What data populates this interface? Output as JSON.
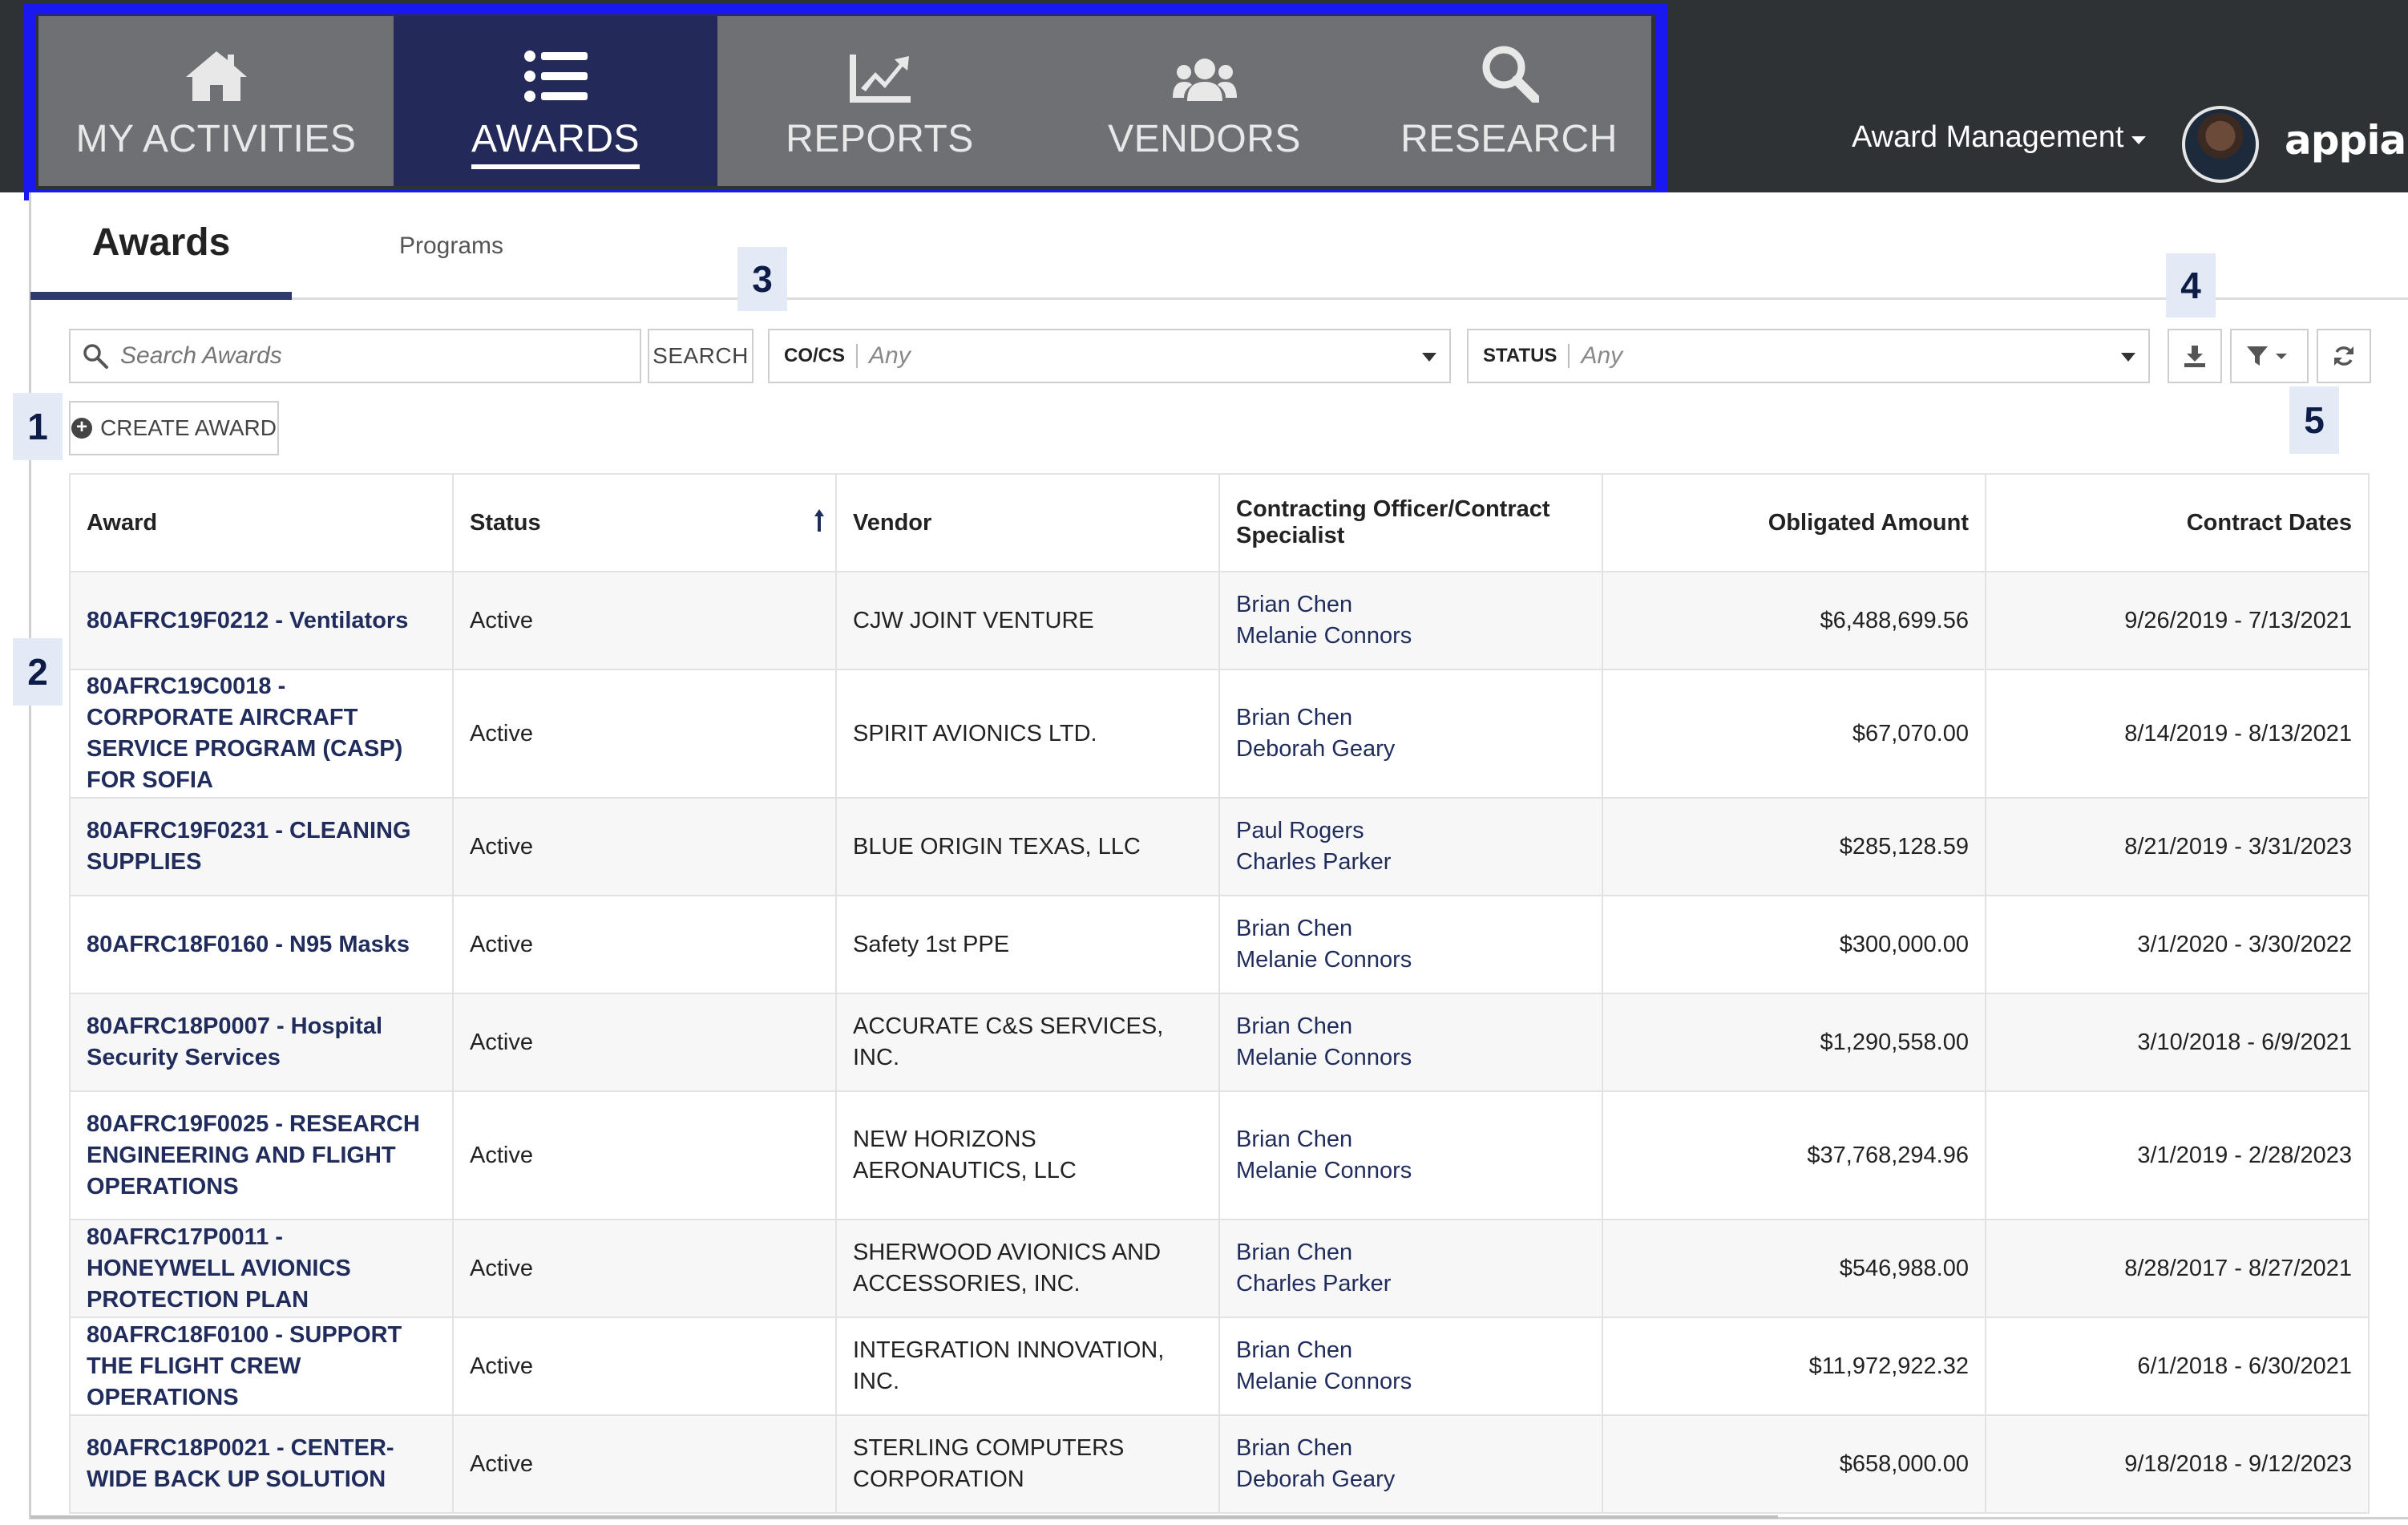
{
  "nav": {
    "items": [
      {
        "label": "MY ACTIVITIES",
        "icon": "home-icon"
      },
      {
        "label": "AWARDS",
        "icon": "list-icon"
      },
      {
        "label": "REPORTS",
        "icon": "chart-icon"
      },
      {
        "label": "VENDORS",
        "icon": "users-icon"
      },
      {
        "label": "RESEARCH",
        "icon": "search-icon"
      }
    ],
    "active": "AWARDS"
  },
  "header": {
    "app_menu_label": "Award Management",
    "logo_text": "appian"
  },
  "tabs": [
    {
      "label": "Awards"
    },
    {
      "label": "Programs"
    }
  ],
  "filters": {
    "search_placeholder": "Search Awards",
    "search_button": "SEARCH",
    "cocs_label": "CO/CS",
    "cocs_value": "Any",
    "status_label": "STATUS",
    "status_value": "Any"
  },
  "actions": {
    "create_award": "CREATE AWARD"
  },
  "badges": [
    "1",
    "2",
    "3",
    "4",
    "5"
  ],
  "table": {
    "columns": [
      "Award",
      "Status",
      "Vendor",
      "Contracting Officer/Contract Specialist",
      "Obligated Amount",
      "Contract Dates"
    ],
    "rows": [
      {
        "award": "80AFRC19F0212 - Ventilators",
        "status": "Active",
        "vendor": "CJW JOINT VENTURE",
        "officer": "Brian Chen",
        "specialist": "Melanie Connors",
        "amount": "$6,488,699.56",
        "dates": "9/26/2019 - 7/13/2021"
      },
      {
        "award": "80AFRC19C0018 - CORPORATE AIRCRAFT SERVICE PROGRAM (CASP) FOR SOFIA",
        "status": "Active",
        "vendor": "SPIRIT AVIONICS LTD.",
        "officer": "Brian Chen",
        "specialist": "Deborah Geary",
        "amount": "$67,070.00",
        "dates": "8/14/2019 - 8/13/2021"
      },
      {
        "award": "80AFRC19F0231 - CLEANING SUPPLIES",
        "status": "Active",
        "vendor": "BLUE ORIGIN TEXAS, LLC",
        "officer": "Paul Rogers",
        "specialist": "Charles Parker",
        "amount": "$285,128.59",
        "dates": "8/21/2019 - 3/31/2023"
      },
      {
        "award": "80AFRC18F0160 - N95 Masks",
        "status": "Active",
        "vendor": "Safety 1st PPE",
        "officer": "Brian Chen",
        "specialist": "Melanie Connors",
        "amount": "$300,000.00",
        "dates": "3/1/2020 - 3/30/2022"
      },
      {
        "award": "80AFRC18P0007 - Hospital Security Services",
        "status": "Active",
        "vendor": "ACCURATE C&S SERVICES, INC.",
        "officer": "Brian Chen",
        "specialist": "Melanie Connors",
        "amount": "$1,290,558.00",
        "dates": "3/10/2018 - 6/9/2021"
      },
      {
        "award": "80AFRC19F0025 - RESEARCH ENGINEERING AND FLIGHT OPERATIONS",
        "status": "Active",
        "vendor": "NEW HORIZONS AERONAUTICS, LLC",
        "officer": "Brian Chen",
        "specialist": "Melanie Connors",
        "amount": "$37,768,294.96",
        "dates": "3/1/2019 - 2/28/2023"
      },
      {
        "award": "80AFRC17P0011 - HONEYWELL AVIONICS PROTECTION PLAN",
        "status": "Active",
        "vendor": "SHERWOOD AVIONICS AND ACCESSORIES, INC.",
        "officer": "Brian Chen",
        "specialist": "Charles Parker",
        "amount": "$546,988.00",
        "dates": "8/28/2017 - 8/27/2021"
      },
      {
        "award": "80AFRC18F0100 - SUPPORT THE FLIGHT CREW OPERATIONS",
        "status": "Active",
        "vendor": "INTEGRATION INNOVATION, INC.",
        "officer": "Brian Chen",
        "specialist": "Melanie Connors",
        "amount": "$11,972,922.32",
        "dates": "6/1/2018 - 6/30/2021"
      },
      {
        "award": "80AFRC18P0021 - CENTER-WIDE BACK UP SOLUTION",
        "status": "Active",
        "vendor": "STERLING COMPUTERS CORPORATION",
        "officer": "Brian Chen",
        "specialist": "Deborah Geary",
        "amount": "$658,000.00",
        "dates": "9/18/2018 - 9/12/2023"
      }
    ]
  },
  "colors": {
    "nav_bg": "#6f7073",
    "nav_active": "#232958",
    "topbar": "#2f3235",
    "highlight_border": "#1a18f0",
    "link": "#1f2c5c",
    "badge_bg": "#e3eaf6"
  }
}
